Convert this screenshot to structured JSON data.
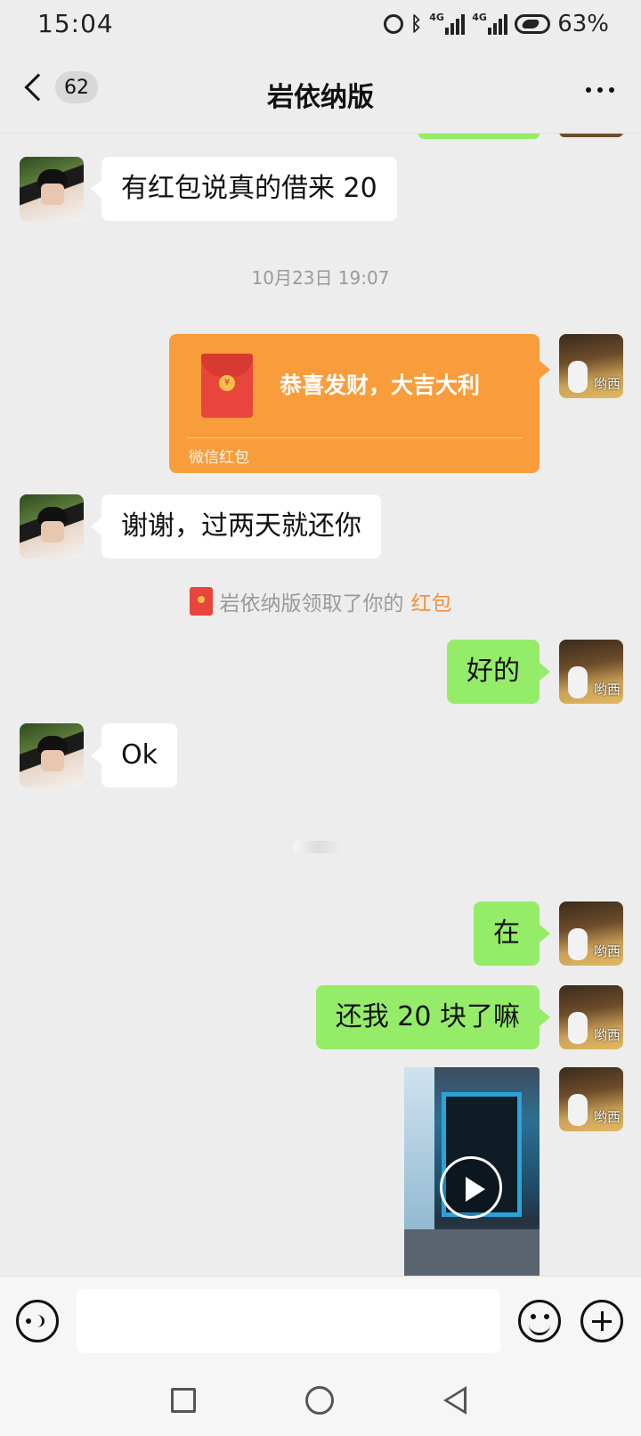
{
  "status_bar": {
    "time": "15:04",
    "net1": "4G",
    "net2": "4G",
    "battery": "63%"
  },
  "header": {
    "unread_count": "62",
    "title": "岩依纳版",
    "more_icon": "more-dots-icon"
  },
  "me_avatar_label": "哟西",
  "messages": {
    "m1": "有红包说真的借来 20",
    "timestamp": "10月23日 19:07",
    "red_packet": {
      "title": "恭喜发财，大吉大利",
      "footer": "微信红包",
      "coin": "¥"
    },
    "m2": "谢谢，过两天就还你",
    "system_prefix": "岩依纳版领取了你的",
    "system_link": "红包",
    "m3": "好的",
    "m4": "Ok",
    "m5": "在",
    "m6": "还我 20 块了嘛"
  },
  "input": {
    "placeholder": ""
  },
  "colors": {
    "bubble_out": "#95ec69",
    "red_packet": "#f99c3b",
    "link_orange": "#f0923a"
  }
}
